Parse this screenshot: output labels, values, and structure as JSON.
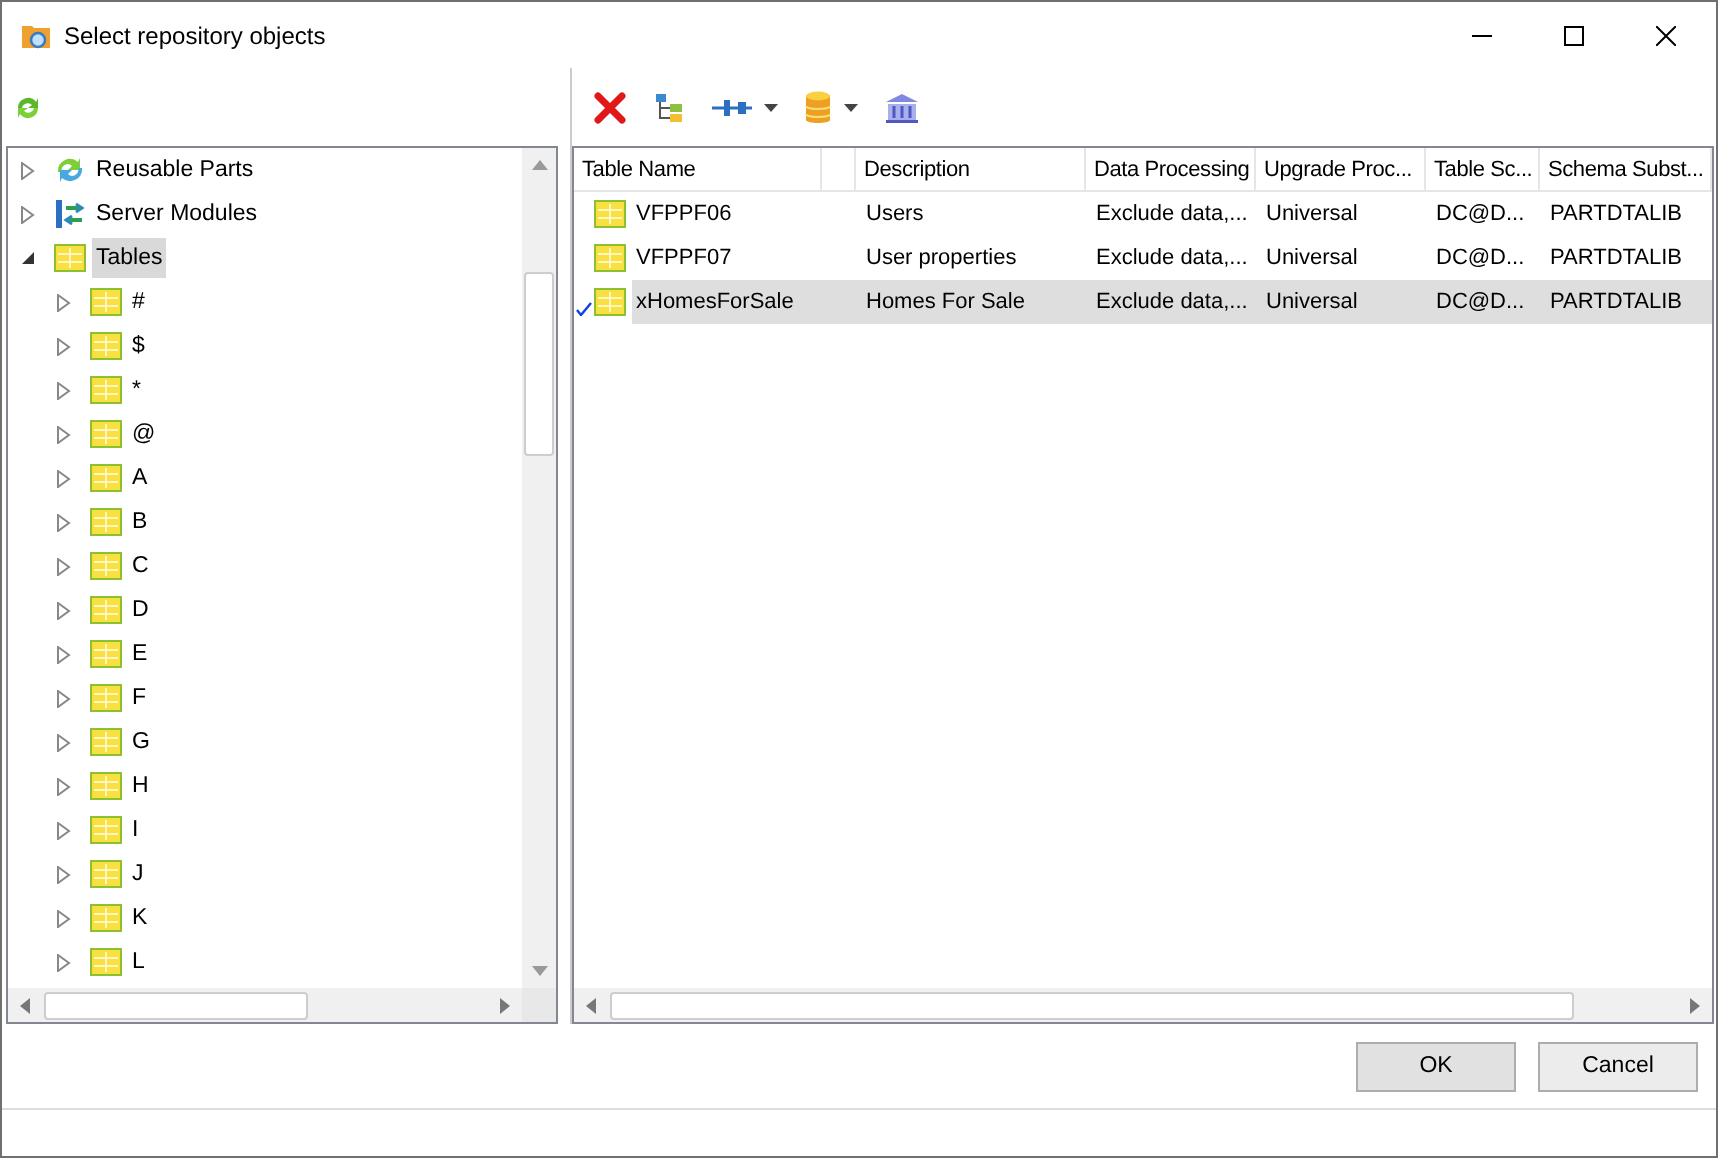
{
  "window": {
    "title": "Select repository objects"
  },
  "tree": [
    {
      "label": "Reusable Parts",
      "kind": "parts",
      "expanded": false,
      "selected": false
    },
    {
      "label": "Server Modules",
      "kind": "modules",
      "expanded": false,
      "selected": false
    },
    {
      "label": "Tables",
      "kind": "table",
      "expanded": true,
      "selected": true,
      "children": [
        {
          "label": "#",
          "kind": "table",
          "expanded": false,
          "selected": false
        },
        {
          "label": "$",
          "kind": "table",
          "expanded": false,
          "selected": false
        },
        {
          "label": "*",
          "kind": "table",
          "expanded": false,
          "selected": false
        },
        {
          "label": "@",
          "kind": "table",
          "expanded": false,
          "selected": false
        },
        {
          "label": "A",
          "kind": "table",
          "expanded": false,
          "selected": false
        },
        {
          "label": "B",
          "kind": "table",
          "expanded": false,
          "selected": false
        },
        {
          "label": "C",
          "kind": "table",
          "expanded": false,
          "selected": false
        },
        {
          "label": "D",
          "kind": "table",
          "expanded": false,
          "selected": false
        },
        {
          "label": "E",
          "kind": "table",
          "expanded": false,
          "selected": false
        },
        {
          "label": "F",
          "kind": "table",
          "expanded": false,
          "selected": false
        },
        {
          "label": "G",
          "kind": "table",
          "expanded": false,
          "selected": false
        },
        {
          "label": "H",
          "kind": "table",
          "expanded": false,
          "selected": false
        },
        {
          "label": "I",
          "kind": "table",
          "expanded": false,
          "selected": false
        },
        {
          "label": "J",
          "kind": "table",
          "expanded": false,
          "selected": false
        },
        {
          "label": "K",
          "kind": "table",
          "expanded": false,
          "selected": false
        },
        {
          "label": "L",
          "kind": "table",
          "expanded": false,
          "selected": false
        }
      ]
    }
  ],
  "table": {
    "columns": [
      "Table Name",
      "",
      "Description",
      "Data Processing",
      "Upgrade Proc...",
      "Table Sc...",
      "Schema Subst..."
    ],
    "rows": [
      {
        "cells": [
          "VFPPF06",
          "",
          "Users",
          "Exclude data,...",
          "Universal",
          "DC@D...",
          "PARTDTALIB"
        ],
        "selected": false,
        "checked": false
      },
      {
        "cells": [
          "VFPPF07",
          "",
          "User properties",
          "Exclude data,...",
          "Universal",
          "DC@D...",
          "PARTDTALIB"
        ],
        "selected": false,
        "checked": false
      },
      {
        "cells": [
          "xHomesForSale",
          "",
          "Homes For Sale",
          "Exclude data,...",
          "Universal",
          "DC@D...",
          "PARTDTALIB"
        ],
        "selected": true,
        "checked": true
      }
    ]
  },
  "buttons": [
    "OK",
    "Cancel"
  ]
}
